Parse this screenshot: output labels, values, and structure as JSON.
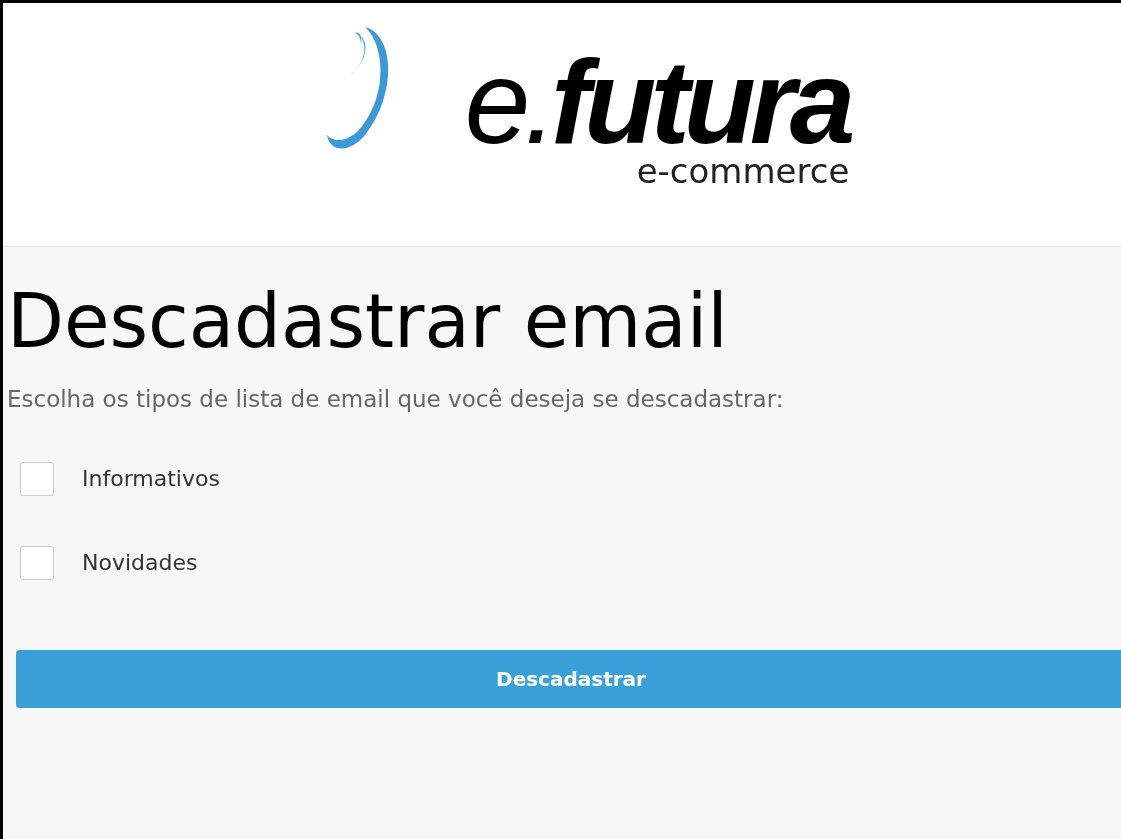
{
  "logo": {
    "name": "e.**futura**",
    "tagline": "e-commerce"
  },
  "title": "Descadastrar email",
  "subtitle": "Escolha os tipos de lista de email que você deseja se descadastrar:",
  "options": [
    {
      "label": "Informativos",
      "checked": false
    },
    {
      "label": "Novidades",
      "checked": false
    }
  ],
  "button": "Descadastrar"
}
